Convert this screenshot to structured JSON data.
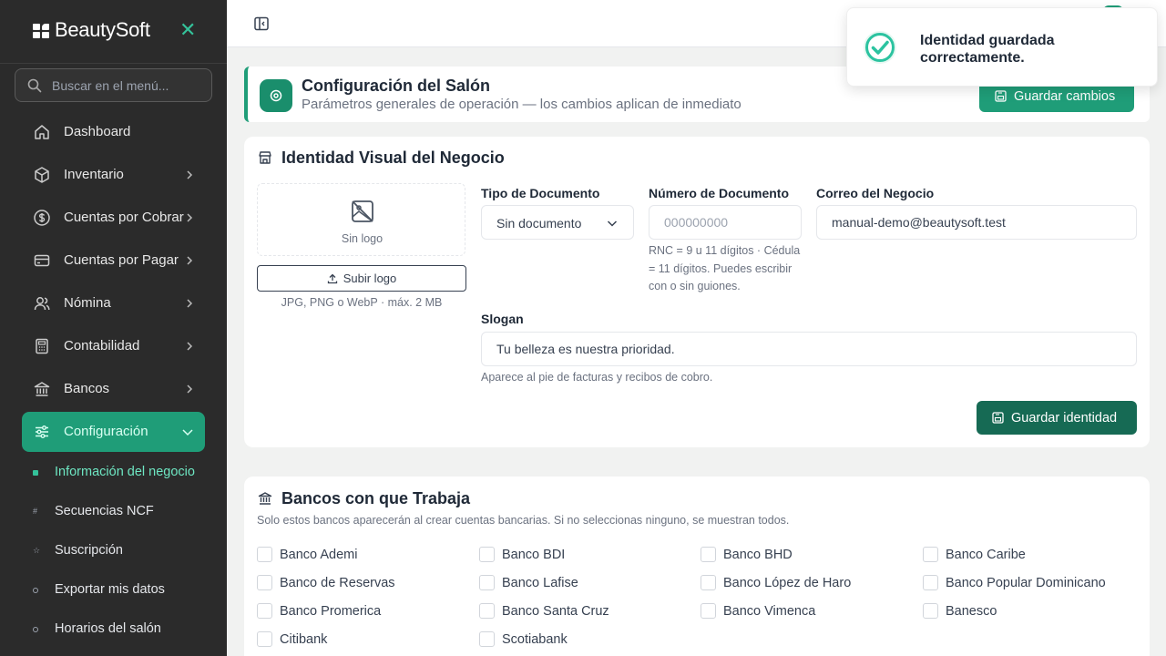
{
  "sidebar": {
    "brand": "BeautySoft",
    "close_icon": "close-icon",
    "search_placeholder": "Buscar en el menú...",
    "items": [
      {
        "label": "Dashboard",
        "icon": "home-icon"
      },
      {
        "label": "Inventario",
        "icon": "box-icon"
      },
      {
        "label": "Cuentas por Cobrar",
        "icon": "dollar-circle-icon"
      },
      {
        "label": "Cuentas por Pagar",
        "icon": "card-icon"
      },
      {
        "label": "Nómina",
        "icon": "users-icon"
      },
      {
        "label": "Contabilidad",
        "icon": "calculator-icon"
      },
      {
        "label": "Bancos",
        "icon": "bank-icon"
      },
      {
        "label": "Configuración",
        "icon": "sliders-icon"
      }
    ],
    "sub_items": [
      {
        "label": "Información del negocio",
        "active": true
      },
      {
        "label": "Secuencias NCF"
      },
      {
        "label": "Suscripción"
      },
      {
        "label": "Exportar mis datos"
      },
      {
        "label": "Horarios del salón"
      }
    ]
  },
  "header": {
    "title": "Configuración del Salón",
    "subtitle": "Parámetros generales de operación — los cambios aplican de inmediato",
    "save_label": "Guardar cambios"
  },
  "identity": {
    "title": "Identidad Visual del Negocio",
    "no_logo": "Sin logo",
    "upload_label": "Subir logo",
    "upload_hint": "JPG, PNG o WebP · máx. 2 MB",
    "doc_type_label": "Tipo de Documento",
    "doc_type_value": "Sin documento",
    "doc_number_label": "Número de Documento",
    "doc_number_placeholder": "000000000",
    "doc_hint": "RNC = 9 u 11 dígitos · Cédula = 11 dígitos. Puedes escribir con o sin guiones.",
    "email_label": "Correo del Negocio",
    "email_value": "manual-demo@beautysoft.test",
    "slogan_label": "Slogan",
    "slogan_value": "Tu belleza es nuestra prioridad.",
    "slogan_hint": "Aparece al pie de facturas y recibos de cobro.",
    "save_label": "Guardar identidad"
  },
  "banks": {
    "title": "Bancos con que Trabaja",
    "description": "Solo estos bancos aparecerán al crear cuentas bancarias. Si no seleccionas ninguno, se muestran todos.",
    "list": [
      "Banco Ademi",
      "Banco BDI",
      "Banco BHD",
      "Banco Caribe",
      "Banco de Reservas",
      "Banco Lafise",
      "Banco López de Haro",
      "Banco Popular Dominicano",
      "Banco Promerica",
      "Banco Santa Cruz",
      "Banco Vimenca",
      "Banesco",
      "Citibank",
      "Scotiabank"
    ]
  },
  "toast": {
    "message": "Identidad guardada correctamente."
  },
  "colors": {
    "accent": "#1f9d78",
    "sidebar_bg": "#2b2b2b",
    "active_sub": "#6ee7c3"
  }
}
